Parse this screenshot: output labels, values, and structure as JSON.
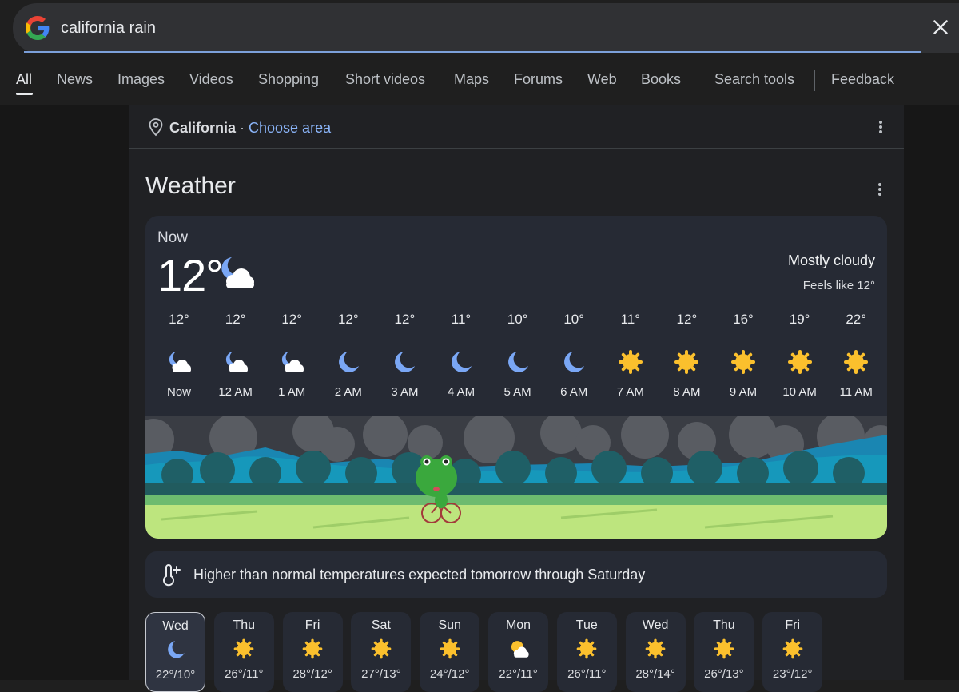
{
  "search": {
    "query": "california rain"
  },
  "tabs": [
    {
      "label": "All"
    },
    {
      "label": "News"
    },
    {
      "label": "Images"
    },
    {
      "label": "Videos"
    },
    {
      "label": "Shopping"
    },
    {
      "label": "Short videos"
    },
    {
      "label": "Maps"
    },
    {
      "label": "Forums"
    },
    {
      "label": "Web"
    },
    {
      "label": "Books"
    },
    {
      "label": "Search tools"
    },
    {
      "label": "Feedback"
    }
  ],
  "location": {
    "place": "California",
    "separator": " · ",
    "change_label": "Choose area"
  },
  "weather": {
    "title": "Weather",
    "now_label": "Now",
    "now_temp": "12°",
    "now_icon": "moon-cloud-icon",
    "condition": "Mostly cloudy",
    "feels_like": "Feels like 12°",
    "hourly": [
      {
        "temp": "12°",
        "time": "Now",
        "icon": "moon-cloud"
      },
      {
        "temp": "12°",
        "time": "12 AM",
        "icon": "moon-cloud"
      },
      {
        "temp": "12°",
        "time": "1 AM",
        "icon": "moon-cloud"
      },
      {
        "temp": "12°",
        "time": "2 AM",
        "icon": "moon"
      },
      {
        "temp": "12°",
        "time": "3 AM",
        "icon": "moon"
      },
      {
        "temp": "11°",
        "time": "4 AM",
        "icon": "moon"
      },
      {
        "temp": "10°",
        "time": "5 AM",
        "icon": "moon"
      },
      {
        "temp": "10°",
        "time": "6 AM",
        "icon": "moon"
      },
      {
        "temp": "11°",
        "time": "7 AM",
        "icon": "sun"
      },
      {
        "temp": "12°",
        "time": "8 AM",
        "icon": "sun"
      },
      {
        "temp": "16°",
        "time": "9 AM",
        "icon": "sun"
      },
      {
        "temp": "19°",
        "time": "10 AM",
        "icon": "sun"
      },
      {
        "temp": "22°",
        "time": "11 AM",
        "icon": "sun"
      }
    ],
    "alert": "Higher than normal temperatures expected tomorrow through Saturday",
    "daily": [
      {
        "day": "Wed",
        "temps": "22°/10°",
        "icon": "moon",
        "selected": true
      },
      {
        "day": "Thu",
        "temps": "26°/11°",
        "icon": "sun"
      },
      {
        "day": "Fri",
        "temps": "28°/12°",
        "icon": "sun"
      },
      {
        "day": "Sat",
        "temps": "27°/13°",
        "icon": "sun"
      },
      {
        "day": "Sun",
        "temps": "24°/12°",
        "icon": "sun"
      },
      {
        "day": "Mon",
        "temps": "22°/11°",
        "icon": "sun-cloud"
      },
      {
        "day": "Tue",
        "temps": "26°/11°",
        "icon": "sun"
      },
      {
        "day": "Wed",
        "temps": "28°/14°",
        "icon": "sun"
      },
      {
        "day": "Thu",
        "temps": "26°/13°",
        "icon": "sun"
      },
      {
        "day": "Fri",
        "temps": "23°/12°",
        "icon": "sun"
      }
    ]
  },
  "colors": {
    "accent": "#8ab4f8",
    "sun": "#fbc02d",
    "moon": "#7aa7f5"
  }
}
